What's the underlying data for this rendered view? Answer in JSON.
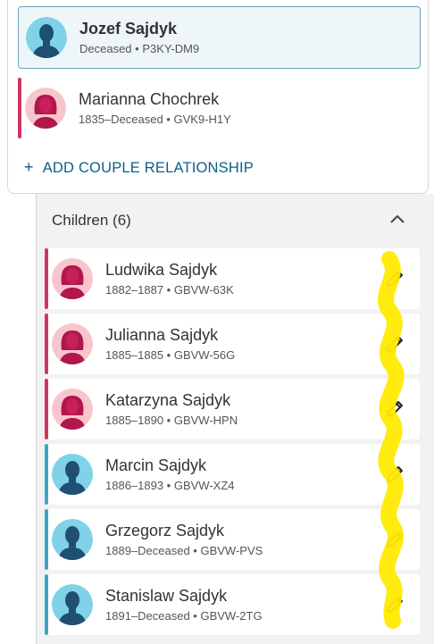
{
  "couple": {
    "primary": {
      "name": "Jozef Sajdyk",
      "meta": "Deceased • P3KY-DM9",
      "gender": "male"
    },
    "spouse": {
      "name": "Marianna Chochrek",
      "meta": "1835–Deceased • GVK9-H1Y",
      "gender": "female"
    },
    "add_label": "ADD COUPLE RELATIONSHIP",
    "add_icon": "plus-icon"
  },
  "children_section": {
    "header": "Children (6)",
    "toggle_icon": "chevron-up-icon",
    "items": [
      {
        "name": "Ludwika Sajdyk",
        "meta": "1882–1887 • GBVW-63K",
        "gender": "female"
      },
      {
        "name": "Julianna Sajdyk",
        "meta": "1885–1885 • GBVW-56G",
        "gender": "female"
      },
      {
        "name": "Katarzyna Sajdyk",
        "meta": "1885–1890 • GBVW-HPN",
        "gender": "female"
      },
      {
        "name": "Marcin Sajdyk",
        "meta": "1886–1893 • GBVW-XZ4",
        "gender": "male"
      },
      {
        "name": "Grzegorz Sajdyk",
        "meta": "1889–Deceased • GBVW-PVS",
        "gender": "male"
      },
      {
        "name": "Stanislaw Sajdyk",
        "meta": "1891–Deceased • GBVW-2TG",
        "gender": "male"
      }
    ]
  },
  "colors": {
    "female_bar": "#d0345f",
    "male_bar": "#3ea6c4",
    "accent": "#0b5f87",
    "highlight": "#ffea00"
  }
}
